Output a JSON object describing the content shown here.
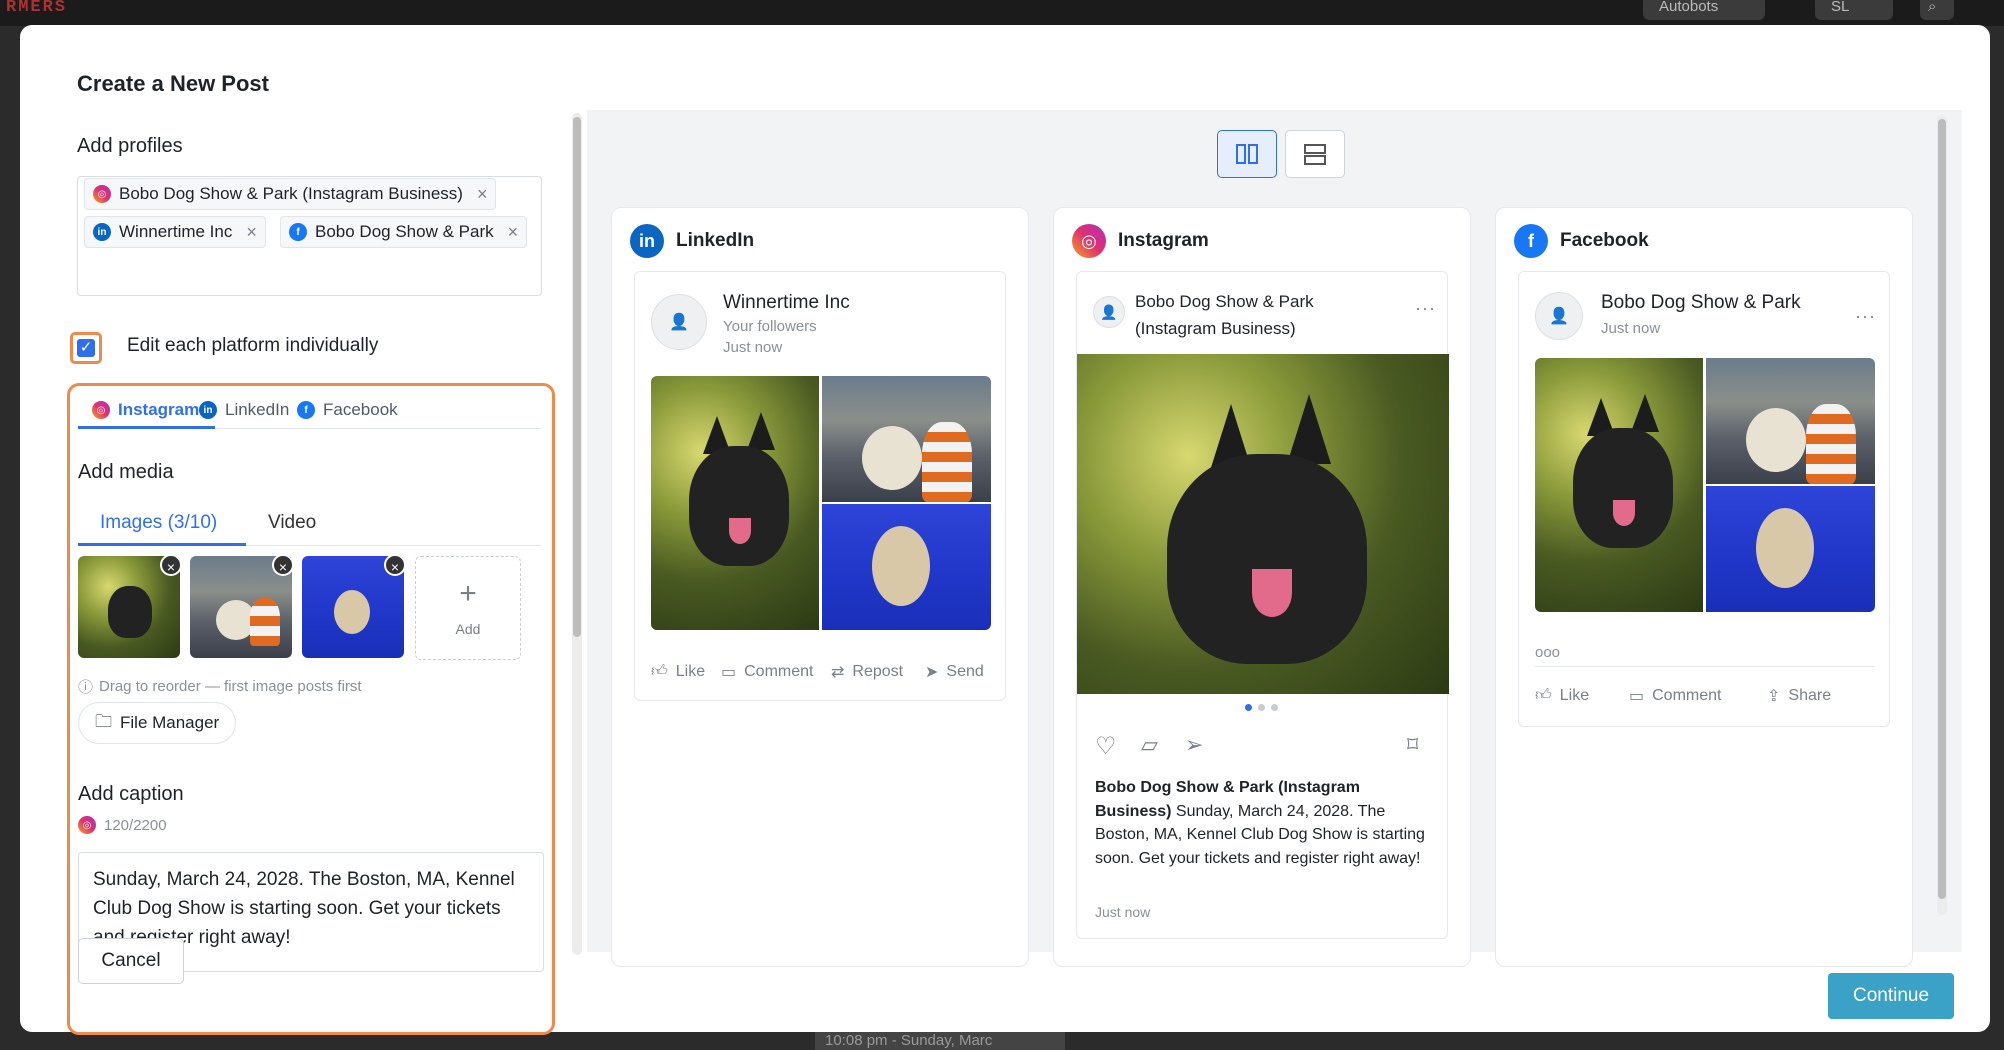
{
  "background": {
    "logo": "RMERS",
    "autobots": "Autobots",
    "user_initials": "SL",
    "taskbar": "10:08 pm - Sunday, Marc"
  },
  "modal": {
    "title": "Create a New Post"
  },
  "profiles": {
    "label": "Add profiles",
    "chips": [
      {
        "name": "Bobo Dog Show & Park (Instagram Business)",
        "platform": "instagram"
      },
      {
        "name": "Winnertime Inc",
        "platform": "linkedin"
      },
      {
        "name": "Bobo Dog Show & Park",
        "platform": "facebook"
      }
    ]
  },
  "edit_individually": {
    "label": "Edit each platform individually",
    "checked": true
  },
  "platform_tabs": [
    "Instagram",
    "LinkedIn",
    "Facebook"
  ],
  "media": {
    "label": "Add media",
    "tabs": [
      "Images (3/10)",
      "Video"
    ],
    "add_label": "Add",
    "hint": "Drag to reorder — first image posts first",
    "file_manager": "File Manager"
  },
  "caption": {
    "label": "Add caption",
    "count": "120/2200",
    "text": "Sunday, March 24, 2028. The Boston, MA, Kennel Club Dog Show is starting soon. Get your tickets and register right away!"
  },
  "buttons": {
    "cancel": "Cancel",
    "continue": "Continue"
  },
  "previews": {
    "linkedin": {
      "title": "LinkedIn",
      "name": "Winnertime Inc",
      "sub1": "Your followers",
      "sub2": "Just now",
      "actions": [
        "Like",
        "Comment",
        "Repost",
        "Send"
      ]
    },
    "instagram": {
      "title": "Instagram",
      "name": "Bobo Dog Show & Park (Instagram Business)",
      "caption_name": "Bobo Dog Show & Park (Instagram Business)",
      "caption_text": "Sunday, March 24, 2028. The Boston, MA, Kennel Club Dog Show is starting soon. Get your tickets and register right away!",
      "time": "Just now"
    },
    "facebook": {
      "title": "Facebook",
      "name": "Bobo Dog Show & Park",
      "sub": "Just now",
      "reactions": "ooo",
      "actions": [
        "Like",
        "Comment",
        "Share"
      ]
    }
  },
  "colors": {
    "accent": "#2f6fec",
    "highlight": "#f08a4b",
    "continue": "#3aa2c6",
    "instagram": "#e1306c",
    "linkedin": "#0a66c2",
    "facebook": "#1877f2"
  }
}
